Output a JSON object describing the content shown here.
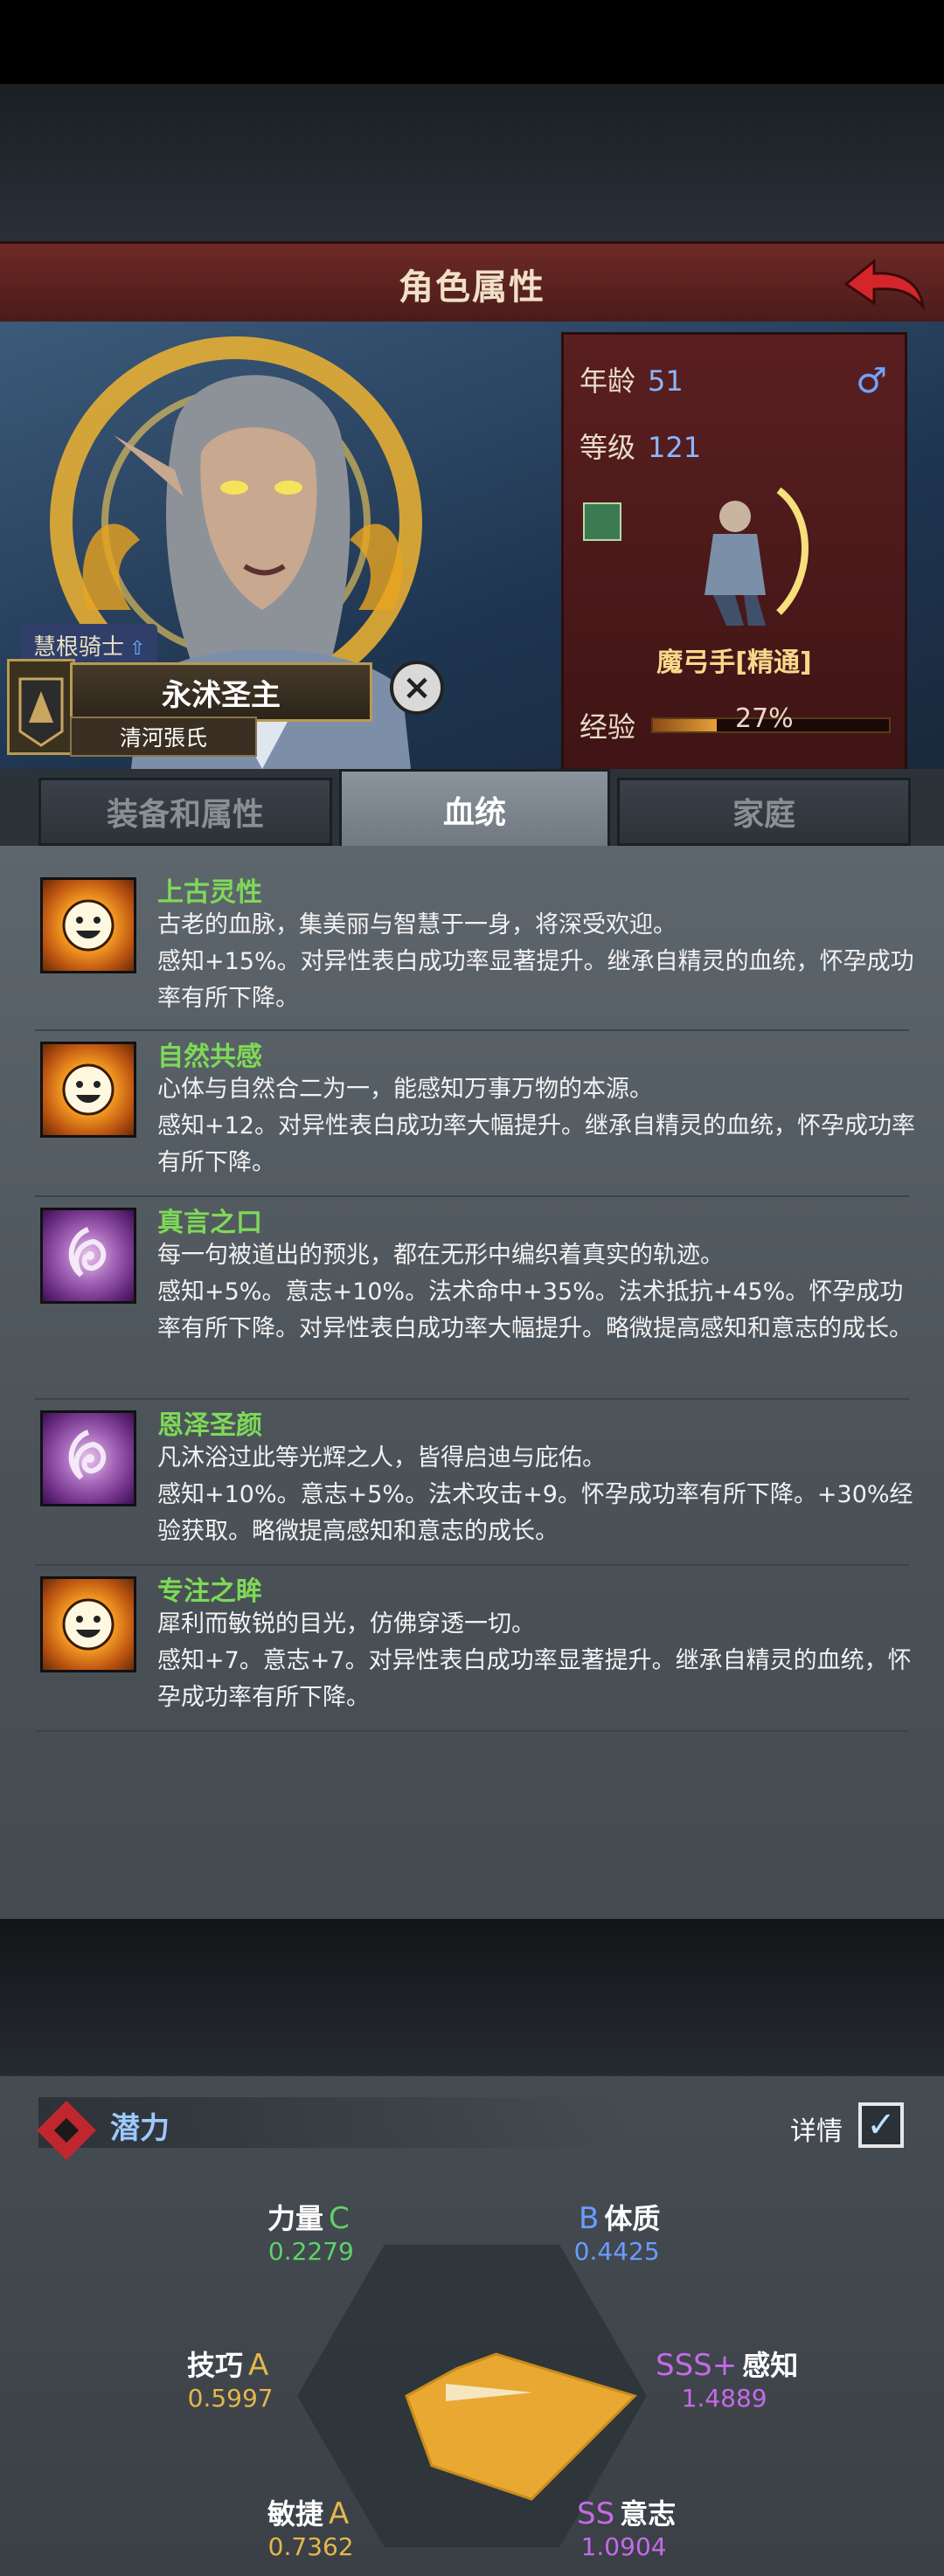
{
  "header": {
    "title": "角色属性"
  },
  "character": {
    "rank_title": "慧根骑士",
    "name": "永沭圣主",
    "clan": "清河張氏",
    "age_label": "年龄",
    "age": "51",
    "level_label": "等级",
    "level": "121",
    "class_name": "魔弓手[精通]",
    "exp_label": "经验",
    "exp_percent": "27%",
    "exp_fraction": 0.27
  },
  "tabs": [
    "装备和属性",
    "血统",
    "家庭"
  ],
  "active_tab": "血统",
  "traits": [
    {
      "name": "上古灵性",
      "icon": "sun-face-icon",
      "desc": "古老的血脉，集美丽与智慧于一身，将深受欢迎。",
      "effect": "感知+15%。对异性表白成功率显著提升。继承自精灵的血统，怀孕成功率有所下降。"
    },
    {
      "name": "自然共感",
      "icon": "sun-face-icon",
      "desc": "心体与自然合二为一，能感知万事万物的本源。",
      "effect": "感知+12。对异性表白成功率大幅提升。继承自精灵的血统，怀孕成功率有所下降。"
    },
    {
      "name": "真言之口",
      "icon": "spiral-eye-icon",
      "desc": "每一句被道出的预兆，都在无形中编织着真实的轨迹。",
      "effect": "感知+5%。意志+10%。法术命中+35%。法术抵抗+45%。怀孕成功率有所下降。对异性表白成功率大幅提升。略微提高感知和意志的成长。"
    },
    {
      "name": "恩泽圣颜",
      "icon": "spiral-eye-icon",
      "desc": "凡沐浴过此等光辉之人，皆得启迪与庇佑。",
      "effect": "感知+10%。意志+5%。法术攻击+9。怀孕成功率有所下降。+30%经验获取。略微提高感知和意志的成长。"
    },
    {
      "name": "专注之眸",
      "icon": "sun-face-icon",
      "desc": "犀利而敏锐的目光，仿佛穿透一切。",
      "effect": "感知+7。意志+7。对异性表白成功率显著提升。继承自精灵的血统，怀孕成功率有所下降。"
    }
  ],
  "potential": {
    "title": "潜力",
    "detail_label": "详情",
    "detail_checked": true,
    "attributes": [
      {
        "name": "力量",
        "grade": "C",
        "value": "0.2279",
        "grade_color": "#5fd16a"
      },
      {
        "name": "体质",
        "grade": "B",
        "value": "0.4425",
        "grade_color": "#6a9cff"
      },
      {
        "name": "感知",
        "grade": "SSS+",
        "value": "1.4889",
        "grade_color": "#c56ae8"
      },
      {
        "name": "意志",
        "grade": "SS",
        "value": "1.0904",
        "grade_color": "#c56ae8"
      },
      {
        "name": "敏捷",
        "grade": "A",
        "value": "0.7362",
        "grade_color": "#e3b84a"
      },
      {
        "name": "技巧",
        "grade": "A",
        "value": "0.5997",
        "grade_color": "#e3b84a"
      }
    ]
  },
  "colors": {
    "trait_name": "#7ed957",
    "value_blue": "#8ab6ff",
    "radar_fill": "#e8a832",
    "title_red": "#6d2a26"
  }
}
